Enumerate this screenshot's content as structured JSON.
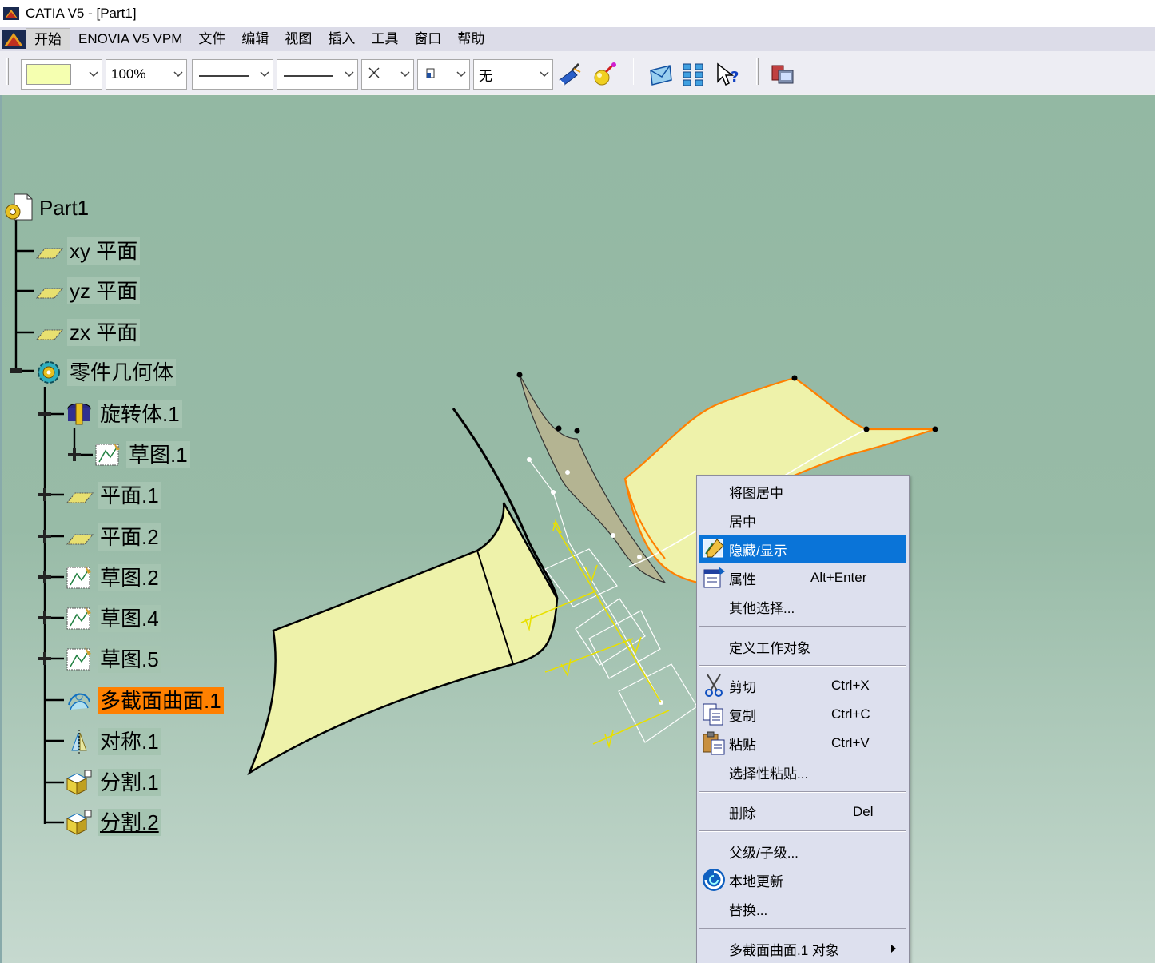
{
  "window": {
    "title": "CATIA V5 - [Part1]"
  },
  "menubar": {
    "items": [
      {
        "label": "开始",
        "active": true
      },
      {
        "label": "ENOVIA V5 VPM"
      },
      {
        "label": "文件"
      },
      {
        "label": "编辑"
      },
      {
        "label": "视图"
      },
      {
        "label": "插入"
      },
      {
        "label": "工具"
      },
      {
        "label": "窗口"
      },
      {
        "label": "帮助"
      }
    ]
  },
  "toolbar": {
    "color_swatch": "#f5ffb0",
    "transparency": "100%",
    "layer": "无"
  },
  "tree": {
    "root": "Part1",
    "xy_plane": "xy 平面",
    "yz_plane": "yz 平面",
    "zx_plane": "zx 平面",
    "part_body": "零件几何体",
    "revolve": "旋转体.1",
    "sketch1": "草图.1",
    "plane1": "平面.1",
    "plane2": "平面.2",
    "sketch2": "草图.2",
    "sketch4": "草图.4",
    "sketch5": "草图.5",
    "multisection": "多截面曲面.1",
    "symmetry": "对称.1",
    "split1": "分割.1",
    "split2": "分割.2"
  },
  "context_menu": {
    "reframe": "将图居中",
    "center": "居中",
    "hide_show": "隐藏/显示",
    "properties": "属性",
    "properties_sc": "Alt+Enter",
    "other_selections": "其他选择...",
    "define_work_object": "定义工作对象",
    "cut": "剪切",
    "cut_sc": "Ctrl+X",
    "copy": "复制",
    "copy_sc": "Ctrl+C",
    "paste": "粘贴",
    "paste_sc": "Ctrl+V",
    "paste_special": "选择性粘贴...",
    "delete": "删除",
    "delete_sc": "Del",
    "parents_children": "父级/子级...",
    "local_update": "本地更新",
    "replace": "替换...",
    "object_submenu": "多截面曲面.1 对象"
  },
  "colors": {
    "selection": "#ff8000",
    "menu_highlight": "#0a74d8",
    "surface": "#eef2aa"
  }
}
